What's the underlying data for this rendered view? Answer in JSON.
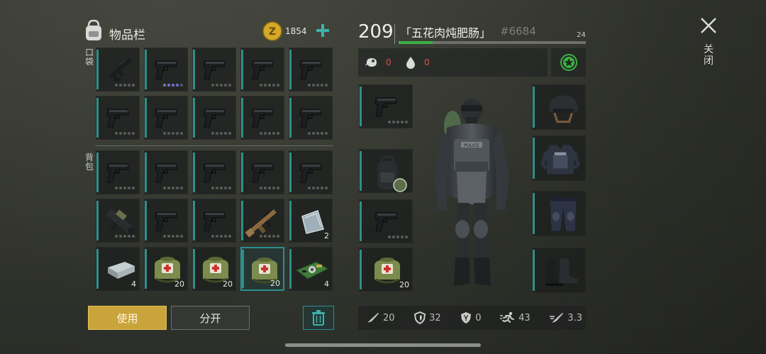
{
  "inventory": {
    "title": "物品栏",
    "coins": "1854",
    "pocket_label": "口袋",
    "backpack_label": "背包",
    "pocket_items": [
      {
        "icon": "rifle-icon",
        "count": "",
        "durability": true,
        "mods": false
      },
      {
        "icon": "pistol-icon",
        "count": "",
        "durability": true,
        "mods": true
      },
      {
        "icon": "pistol-icon",
        "count": "",
        "durability": true,
        "mods": false
      },
      {
        "icon": "pistol-icon",
        "count": "",
        "durability": true,
        "mods": false
      },
      {
        "icon": "pistol-icon",
        "count": "",
        "durability": true,
        "mods": false
      },
      {
        "icon": "pistol-icon",
        "count": "",
        "durability": true,
        "mods": false
      },
      {
        "icon": "pistol-icon",
        "count": "",
        "durability": true,
        "mods": false
      },
      {
        "icon": "pistol-icon",
        "count": "",
        "durability": true,
        "mods": false
      },
      {
        "icon": "pistol-icon",
        "count": "",
        "durability": true,
        "mods": false
      },
      {
        "icon": "pistol-icon",
        "count": "",
        "durability": true,
        "mods": false
      }
    ],
    "backpack_items": [
      {
        "icon": "pistol-icon",
        "count": "",
        "durability": true
      },
      {
        "icon": "pistol-icon",
        "count": "",
        "durability": true
      },
      {
        "icon": "pistol-icon",
        "count": "",
        "durability": true
      },
      {
        "icon": "pistol-icon",
        "count": "",
        "durability": true
      },
      {
        "icon": "pistol-icon",
        "count": "",
        "durability": true
      },
      {
        "icon": "grenade-launcher-icon",
        "count": "",
        "durability": true
      },
      {
        "icon": "pistol-icon",
        "count": "",
        "durability": true
      },
      {
        "icon": "pistol-icon",
        "count": "",
        "durability": true
      },
      {
        "icon": "assault-rifle-icon",
        "count": "",
        "durability": true
      },
      {
        "icon": "steel-plate-icon",
        "count": "2",
        "durability": false
      },
      {
        "icon": "metal-ingot-icon",
        "count": "4",
        "durability": false
      },
      {
        "icon": "medkit-bag-icon",
        "count": "20",
        "durability": false
      },
      {
        "icon": "medkit-bag-icon",
        "count": "20",
        "durability": false
      },
      {
        "icon": "medkit-bag-icon",
        "count": "20",
        "durability": false,
        "selected": true
      },
      {
        "icon": "circuit-board-icon",
        "count": "4",
        "durability": false
      }
    ],
    "use_button": "使用",
    "split_button": "分开"
  },
  "character": {
    "level": "209",
    "name": "「五花肉炖肥肠」",
    "id": "#6684",
    "xp_level": "24",
    "xp_progress": 0.18,
    "hunger": "0",
    "thirst": "0",
    "weapon_slots": [
      {
        "icon": "pistol-icon",
        "count": "",
        "durability": true
      },
      {
        "icon": "backpack-icon",
        "count": "",
        "durability": false
      },
      {
        "icon": "pistol-icon",
        "count": "",
        "durability": true
      },
      {
        "icon": "medkit-bag-icon",
        "count": "20",
        "durability": false
      }
    ],
    "armor_slots": [
      {
        "icon": "helmet-icon"
      },
      {
        "icon": "vest-icon"
      },
      {
        "icon": "pants-icon"
      },
      {
        "icon": "boots-icon"
      }
    ],
    "stats": {
      "attack": "20",
      "defense": "32",
      "radiation": "0",
      "speed": "43",
      "damage": "3.3"
    }
  },
  "close_label": "关闭",
  "colors": {
    "accent": "#2f8f8a",
    "coin": "#d6a82a",
    "use_button_bg": "#c9a43a",
    "xp_bar": "#3cb043",
    "delete_button": "#2a8f8f"
  }
}
